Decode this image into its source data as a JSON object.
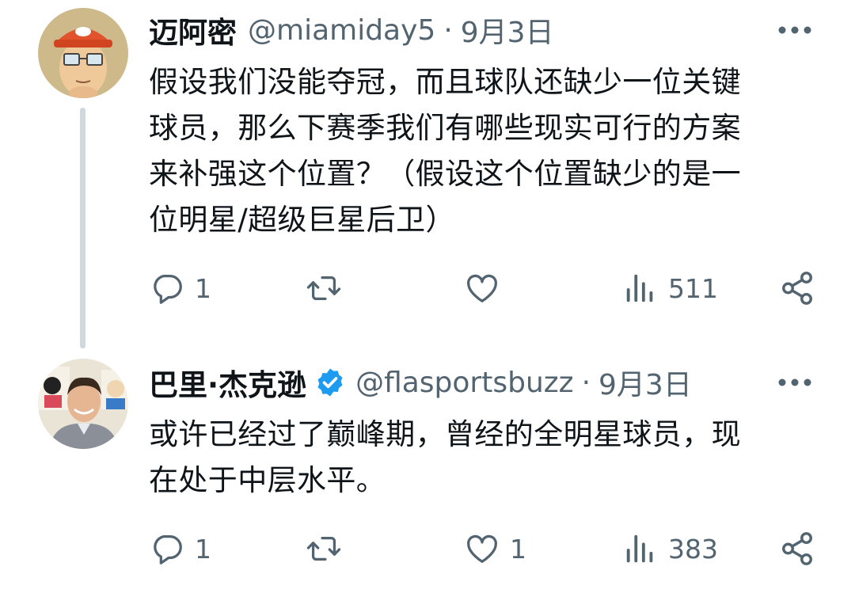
{
  "tweets": [
    {
      "display_name": "迈阿密",
      "handle": "@miamiday5",
      "separator": "·",
      "date": "9月3日",
      "verified": false,
      "text_lines": [
        "假设我们没能夺冠，而且球队还缺少一位关键",
        "球员，那么下赛季我们有哪些现实可行的方案",
        "来补强这个位置？（假设这个位置缺少的是一",
        "位明星/超级巨星后卫）"
      ],
      "replies": "1",
      "reposts": "",
      "likes": "",
      "views": "511",
      "icons": {
        "avatar": "cartoon-avatar",
        "more": "more-icon",
        "reply": "reply-icon",
        "repost": "repost-icon",
        "like": "heart-icon",
        "views": "views-icon",
        "share": "share-icon"
      }
    },
    {
      "display_name": "巴里·杰克逊",
      "handle": "@flasportsbuzz",
      "separator": "·",
      "date": "9月3日",
      "verified": true,
      "text_lines": [
        "或许已经过了巅峰期，曾经的全明星球员，现",
        "在处于中层水平。"
      ],
      "replies": "1",
      "reposts": "",
      "likes": "1",
      "views": "383",
      "icons": {
        "avatar": "profile-photo-avatar",
        "verified": "verified-badge-icon",
        "more": "more-icon",
        "reply": "reply-icon",
        "repost": "repost-icon",
        "like": "heart-icon",
        "views": "views-icon",
        "share": "share-icon"
      }
    }
  ],
  "colors": {
    "text_primary": "#0f1419",
    "text_secondary": "#536471",
    "thread_line": "#cfd9de",
    "verified_blue": "#1d9bf0",
    "background": "#ffffff"
  }
}
